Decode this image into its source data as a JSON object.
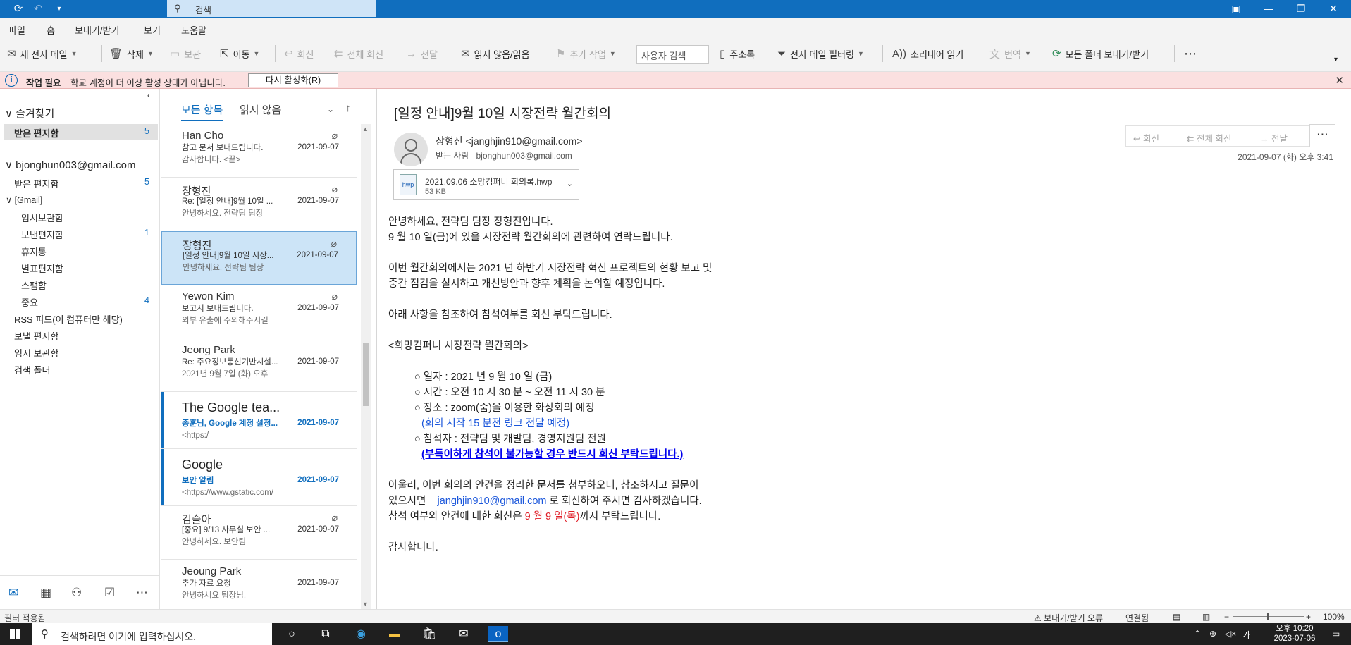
{
  "titlebar": {
    "search_label": "검색"
  },
  "menu": [
    "파일",
    "홈",
    "보내기/받기",
    "보기",
    "도움말"
  ],
  "ribbon": {
    "new_mail": "새 전자 메일",
    "delete": "삭제",
    "archive": "보관",
    "move": "이동",
    "reply": "회신",
    "reply_all": "전체 회신",
    "forward": "전달",
    "read_unread": "읽지 않음/읽음",
    "more_actions": "추가 작업",
    "user_search_placeholder": "사용자 검색",
    "address_book": "주소록",
    "filter_mail": "전자 메일 필터링",
    "read_aloud": "소리내어 읽기",
    "translate": "번역",
    "send_receive_all": "모든 폴더 보내기/받기"
  },
  "infobar": {
    "title": "작업 필요",
    "message": "학교 계정이 더 이상 활성 상태가 아닙니다.",
    "button": "다시 활성화(R)"
  },
  "folders": {
    "favorites_header": "즐겨찾기",
    "favorites": [
      {
        "label": "받은 편지함",
        "count": "5"
      }
    ],
    "account": "bjonghun003@gmail.com",
    "inbox": {
      "label": "받은 편지함",
      "count": "5"
    },
    "gmail_header": "[Gmail]",
    "gmail_items": [
      {
        "label": "임시보관함",
        "count": ""
      },
      {
        "label": "보낸편지함",
        "count": "1"
      },
      {
        "label": "휴지통",
        "count": ""
      },
      {
        "label": "별표편지함",
        "count": ""
      },
      {
        "label": "스팸함",
        "count": ""
      },
      {
        "label": "중요",
        "count": "4"
      }
    ],
    "other_items": [
      {
        "label": "RSS 피드(이 컴퓨터만 해당)"
      },
      {
        "label": "보낼 편지함"
      },
      {
        "label": "임시 보관함"
      },
      {
        "label": "검색 폴더"
      }
    ]
  },
  "maillist": {
    "tab_all": "모든 항목",
    "tab_unread": "읽지 않음",
    "items": [
      {
        "from": "Han Cho",
        "subject": "참고 문서 보내드립니다.",
        "preview": "감사합니다. <끝>",
        "date": "2021-09-07",
        "attach": true,
        "unread": false,
        "selected": false
      },
      {
        "from": "장형진",
        "subject": "Re: [일정 안내]9월 10일 ...",
        "preview": "안녕하세요. 전략팀 팀장",
        "date": "2021-09-07",
        "attach": true,
        "unread": false,
        "selected": false
      },
      {
        "from": "장형진",
        "subject": "[일정 안내]9월 10일 시장...",
        "preview": "안녕하세요, 전략팀 팀장",
        "date": "2021-09-07",
        "attach": true,
        "unread": false,
        "selected": true
      },
      {
        "from": "Yewon Kim",
        "subject": "보고서 보내드립니다.",
        "preview": "외부 유출에 주의해주시길",
        "date": "2021-09-07",
        "attach": true,
        "unread": false,
        "selected": false
      },
      {
        "from": "Jeong Park",
        "subject": "Re: 주요정보통신기반시설...",
        "preview": "2021년 9월 7일 (화) 오후",
        "date": "2021-09-07",
        "attach": false,
        "unread": false,
        "selected": false
      },
      {
        "from": "The Google tea...",
        "subject": "종훈님, Google 계정 설정...",
        "preview": "<https:/",
        "date": "2021-09-07",
        "attach": false,
        "unread": true,
        "selected": false
      },
      {
        "from": "Google",
        "subject": "보안 알림",
        "preview": "<https://www.gstatic.com/",
        "date": "2021-09-07",
        "attach": false,
        "unread": true,
        "selected": false
      },
      {
        "from": "김슬아",
        "subject": "[중요] 9/13 사무실 보안 ...",
        "preview": "안녕하세요. 보안팀",
        "date": "2021-09-07",
        "attach": true,
        "unread": false,
        "selected": false
      },
      {
        "from": "Jeoung Park",
        "subject": "추가 자료 요청",
        "preview": "안녕하세요 팀장님,",
        "date": "2021-09-07",
        "attach": false,
        "unread": false,
        "selected": false
      }
    ]
  },
  "message": {
    "subject": "[일정 안내]9월 10일 시장전략 월간회의",
    "sender": "장형진 <janghjin910@gmail.com>",
    "to_label": "받는 사람",
    "to_value": "bjonghun003@gmail.com",
    "attachment_name": "2021.09.06 소망컴퍼니 회의록.hwp",
    "attachment_size": "53 KB",
    "attachment_icon_text": "hwp",
    "reply": "회신",
    "reply_all": "전체 회신",
    "forward": "전달",
    "date": "2021-09-07 (화) 오후 3:41",
    "body": {
      "l1": "안녕하세요, 전략팀 팀장 장형진입니다.",
      "l2": "9 월 10 일(금)에 있을 시장전략 월간회의에 관련하여 연락드립니다.",
      "l3": "이번 월간회의에서는 2021 년 하반기 시장전략 혁신 프로젝트의 현황 보고 및",
      "l4": "중간 점검을 실시하고 개선방안과 향후 계획을 논의할 예정입니다.",
      "l5": "아래 사항을 참조하여 참석여부를 회신 부탁드립니다.",
      "l6": "<희망컴퍼니 시장전략 월간회의>",
      "b1": "○ 일자 : 2021 년 9 월 10 일 (금)",
      "b2": "○ 시간 : 오전 10 시 30 분 ~ 오전 11 시 30 분",
      "b3": "○ 장소 : zoom(줌)을 이용한 화상회의 예정",
      "b3n": "(회의 시작 15 분전 링크 전달 예정)",
      "b4": "○ 참석자 : 전략팀 및 개발팀, 경영지원팀 전원",
      "b4n": "(부득이하게 참석이 불가능할 경우 반드시 회신 부탁드립니다.)",
      "l7": "아울러, 이번 회의의 안건을 정리한 문서를 첨부하오니, 참조하시고 질문이",
      "l8a": "있으시면",
      "l8link": "janghjin910@gmail.com",
      "l8b": "로 회신하여 주시면 감사하겠습니다.",
      "l9a": "참석 여부와 안건에 대한 회신은",
      "l9red": "9 월 9 일(목)",
      "l9b": "까지 부탁드립니다.",
      "l10": "감사합니다."
    }
  },
  "statusbar": {
    "left": "필터 적용됨",
    "error": "보내기/받기 오류",
    "connected": "연결됨",
    "zoom": "100%"
  },
  "taskbar": {
    "search_placeholder": "검색하려면 여기에 입력하십시오.",
    "ime": "가",
    "time": "오후 10:20",
    "date": "2023-07-06"
  }
}
